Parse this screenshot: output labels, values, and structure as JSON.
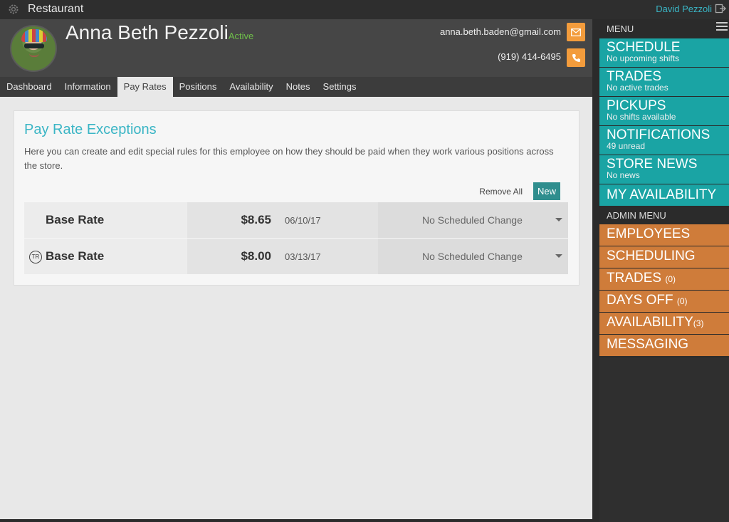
{
  "topbar": {
    "app_name": "Restaurant",
    "user_name": "David Pezzoli",
    "icons": [
      "gear-icon",
      "logout-icon"
    ]
  },
  "profile": {
    "name": "Anna Beth Pezzoli",
    "status": "Active",
    "email": "anna.beth.baden@gmail.com",
    "phone": "(919) 414-6495",
    "status_color": "#6fbf4a",
    "action_color": "#f39c3c"
  },
  "tabs": [
    {
      "label": "Dashboard"
    },
    {
      "label": "Information"
    },
    {
      "label": "Pay Rates",
      "active": true
    },
    {
      "label": "Positions"
    },
    {
      "label": "Availability"
    },
    {
      "label": "Notes"
    },
    {
      "label": "Settings"
    }
  ],
  "pay_rates": {
    "title": "Pay Rate Exceptions",
    "description": "Here you can create and edit special rules for this employee on how they should be paid when they work various positions across the store.",
    "remove_all_label": "Remove All",
    "new_label": "New",
    "rows": [
      {
        "label": "Base Rate",
        "badge": "",
        "amount": "$8.65",
        "date": "06/10/17",
        "change": "No Scheduled Change"
      },
      {
        "label": "Base Rate",
        "badge": "TR",
        "amount": "$8.00",
        "date": "03/13/17",
        "change": "No Scheduled Change"
      }
    ]
  },
  "sidebar": {
    "menu_label": "MENU",
    "admin_label": "ADMIN MENU",
    "teal_color": "#1aa4a4",
    "orange_color": "#cf7c3a",
    "menu": [
      {
        "label": "SCHEDULE",
        "sub": "No upcoming shifts"
      },
      {
        "label": "TRADES",
        "sub": "No active trades"
      },
      {
        "label": "PICKUPS",
        "sub": "No shifts available"
      },
      {
        "label": "NOTIFICATIONS",
        "sub": "49 unread"
      },
      {
        "label": "STORE NEWS",
        "sub": "No news"
      },
      {
        "label": "MY AVAILABILITY",
        "sub": ""
      }
    ],
    "admin": [
      {
        "label": "EMPLOYEES",
        "count": ""
      },
      {
        "label": "SCHEDULING",
        "count": ""
      },
      {
        "label": "TRADES",
        "count": "(0)"
      },
      {
        "label": "DAYS OFF",
        "count": "(0)"
      },
      {
        "label": "AVAILABILITY",
        "count": "(3)"
      },
      {
        "label": "MESSAGING",
        "count": ""
      }
    ]
  }
}
